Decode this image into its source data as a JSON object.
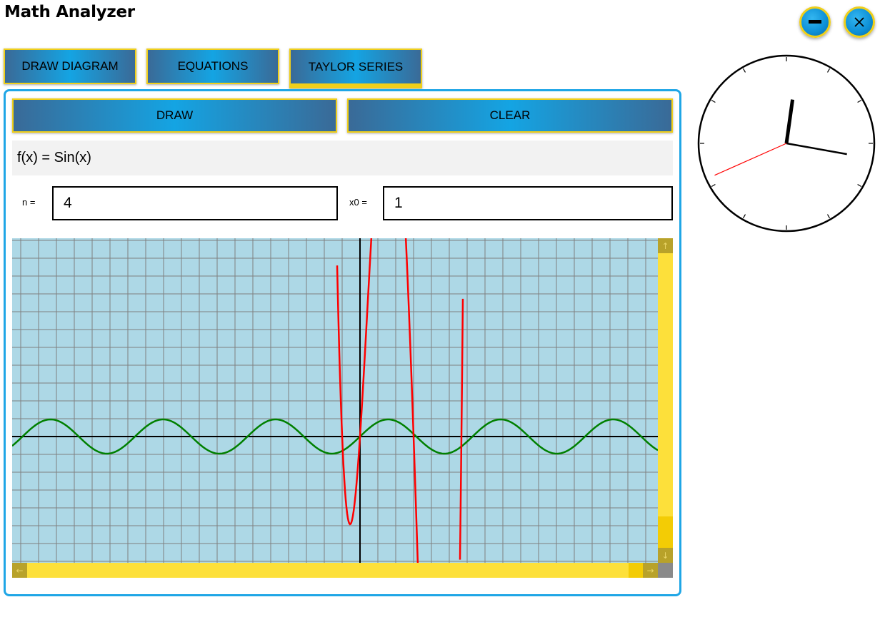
{
  "app": {
    "title": "Math Analyzer"
  },
  "window_controls": {
    "minimize_icon": "minus-icon",
    "close_icon": "close-icon",
    "accent": "#14a4e3",
    "border": "#f0cf1a"
  },
  "tabs": [
    {
      "label": "DRAW DIAGRAM",
      "active": false
    },
    {
      "label": "EQUATIONS",
      "active": false
    },
    {
      "label": "TAYLOR SERIES",
      "active": true
    }
  ],
  "actions": {
    "draw_label": "DRAW",
    "clear_label": "CLEAR"
  },
  "function": {
    "text": "f(x) = Sin(x)"
  },
  "params": {
    "n_label": "n =",
    "n_value": "4",
    "x0_label": "x0 =",
    "x0_value": "1"
  },
  "scrollbars": {
    "up_icon": "arrow-up-icon",
    "down_icon": "arrow-down-icon",
    "left_icon": "arrow-left-icon",
    "right_icon": "arrow-right-icon"
  },
  "graph": {
    "background": "#add8e6",
    "grid_color": "#808080",
    "function_color": "#008000",
    "taylor_color": "#ff0000"
  },
  "clock": {
    "hour": 12,
    "minute": 16,
    "second": 41
  }
}
